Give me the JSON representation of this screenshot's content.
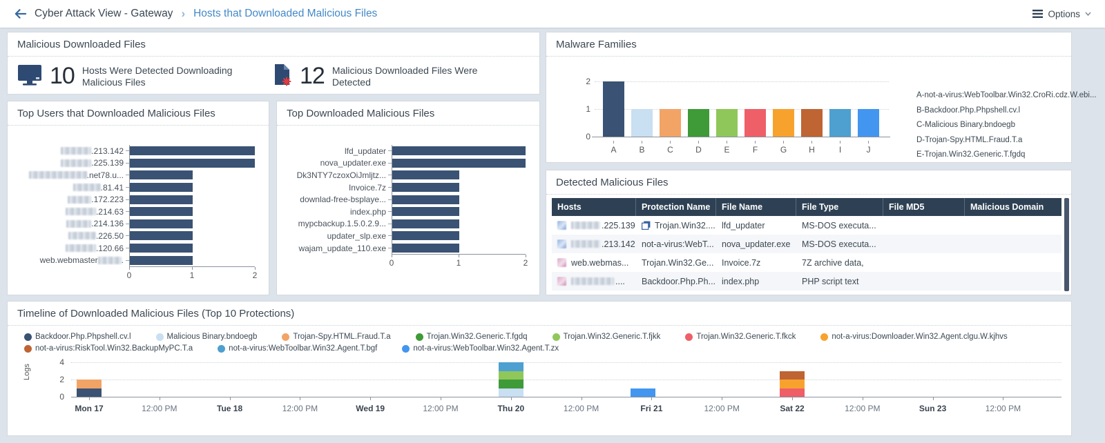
{
  "palette": {
    "navy": "#3a5273",
    "lightblue": "#c9dff2",
    "orange": "#f2a466",
    "green": "#3f9a38",
    "lightgreen": "#90c75a",
    "red": "#ee5f68",
    "amber": "#f8a22e",
    "rust": "#bf6433",
    "steel": "#4da0cf",
    "blue": "#4296f0"
  },
  "header": {
    "breadcrumb_root": "Cyber Attack View - Gateway",
    "breadcrumb_current": "Hosts that Downloaded Malicious Files",
    "options_label": "Options"
  },
  "summary": {
    "title": "Malicious Downloaded Files",
    "stats": [
      {
        "icon": "monitor-icon",
        "value": "10",
        "label": "Hosts Were Detected Downloading Malicious Files"
      },
      {
        "icon": "infected-file-icon",
        "value": "12",
        "label": "Malicious Downloaded Files Were Detected"
      }
    ]
  },
  "top_users": {
    "title": "Top Users that Downloaded Malicious Files",
    "xticks": [
      "0",
      "1",
      "2"
    ],
    "xmax": 2,
    "rows": [
      {
        "redact": 44,
        "label": ".213.142",
        "value": 2
      },
      {
        "redact": 44,
        "label": ".225.139",
        "value": 2
      },
      {
        "redact": 84,
        "label": ".net78.u...",
        "value": 1
      },
      {
        "redact": 40,
        "label": ".81.41",
        "value": 1
      },
      {
        "redact": 34,
        "label": ".172.223",
        "value": 1
      },
      {
        "redact": 44,
        "label": ".214.63",
        "value": 1
      },
      {
        "redact": 36,
        "label": ".214.136",
        "value": 1
      },
      {
        "redact": 40,
        "label": ".226.50",
        "value": 1
      },
      {
        "redact": 44,
        "label": ".120.66",
        "value": 1
      },
      {
        "pre": "web.webmaster",
        "redact": 34,
        "label": ".",
        "value": 1
      }
    ]
  },
  "top_files": {
    "title": "Top Downloaded Malicious Files",
    "xticks": [
      "0",
      "1",
      "2"
    ],
    "xmax": 2,
    "rows": [
      {
        "label": "lfd_updater",
        "value": 2
      },
      {
        "label": "nova_updater.exe",
        "value": 2
      },
      {
        "label": "Dk3NTY7czoxOiJmljtz...",
        "value": 1
      },
      {
        "label": "Invoice.7z",
        "value": 1
      },
      {
        "label": "downlad-free-bsplaye...",
        "value": 1
      },
      {
        "label": "index.php",
        "value": 1
      },
      {
        "label": "mypcbackup.1.5.0.2.9...",
        "value": 1
      },
      {
        "label": "updater_slp.exe",
        "value": 1
      },
      {
        "label": "wajam_update_110.exe",
        "value": 1
      }
    ]
  },
  "malware_families": {
    "title": "Malware Families",
    "yticks": [
      "2",
      "1",
      "0"
    ],
    "ymax": 2,
    "bars": [
      {
        "label": "A",
        "value": 2,
        "color": "navy"
      },
      {
        "label": "B",
        "value": 1,
        "color": "lightblue"
      },
      {
        "label": "C",
        "value": 1,
        "color": "orange"
      },
      {
        "label": "D",
        "value": 1,
        "color": "green"
      },
      {
        "label": "E",
        "value": 1,
        "color": "lightgreen"
      },
      {
        "label": "F",
        "value": 1,
        "color": "red"
      },
      {
        "label": "G",
        "value": 1,
        "color": "amber"
      },
      {
        "label": "H",
        "value": 1,
        "color": "rust"
      },
      {
        "label": "I",
        "value": 1,
        "color": "steel"
      },
      {
        "label": "J",
        "value": 1,
        "color": "blue"
      }
    ],
    "legend": [
      "A-not-a-virus:WebToolbar.Win32.CroRi.cdz.W.ebi...",
      "B-Backdoor.Php.Phpshell.cv.l",
      "C-Malicious Binary.bndoegb",
      "D-Trojan-Spy.HTML.Fraud.T.a",
      "E-Trojan.Win32.Generic.T.fgdq"
    ]
  },
  "detected_files": {
    "title": "Detected Malicious Files",
    "columns": [
      "Hosts",
      "Protection Name",
      "File Name",
      "File Type",
      "File MD5",
      "Malicious Domain"
    ],
    "rows": [
      {
        "host_icon": "blue",
        "host_redact": 42,
        "host": ".225.139",
        "protection_icon": true,
        "protection": "Trojan.Win32....",
        "file_name": "lfd_updater",
        "file_type": "MS-DOS executa...",
        "file_md5": "",
        "malicious_domain": ""
      },
      {
        "host_icon": "blue",
        "host_redact": 42,
        "host": ".213.142",
        "protection_icon": false,
        "protection": "not-a-virus:WebT...",
        "file_name": "nova_updater.exe",
        "file_type": "MS-DOS executa...",
        "file_md5": "",
        "malicious_domain": ""
      },
      {
        "host_icon": "pink",
        "host_redact": 0,
        "host": "web.webmas...",
        "protection_icon": false,
        "protection": "Trojan.Win32.Ge...",
        "file_name": "Invoice.7z",
        "file_type": "7Z archive data,",
        "file_md5": "",
        "malicious_domain": ""
      },
      {
        "host_icon": "pink",
        "host_redact": 62,
        "host": "....",
        "protection_icon": false,
        "protection": "Backdoor.Php.Ph...",
        "file_name": "index.php",
        "file_type": "PHP script text",
        "file_md5": "",
        "malicious_domain": ""
      }
    ]
  },
  "timeline": {
    "title": "Timeline of Downloaded Malicious Files (Top 10 Protections)",
    "ylabel": "Logs",
    "yticks": [
      "4",
      "2",
      "0"
    ],
    "ymax": 4,
    "legend_rows": [
      [
        {
          "label": "Backdoor.Php.Phpshell.cv.l",
          "color": "navy"
        },
        {
          "label": "Malicious Binary.bndoegb",
          "color": "lightblue"
        },
        {
          "label": "Trojan-Spy.HTML.Fraud.T.a",
          "color": "orange"
        },
        {
          "label": "Trojan.Win32.Generic.T.fgdq",
          "color": "green"
        },
        {
          "label": "Trojan.Win32.Generic.T.fjkk",
          "color": "lightgreen"
        },
        {
          "label": "Trojan.Win32.Generic.T.fkck",
          "color": "red"
        },
        {
          "label": "not-a-virus:Downloader.Win32.Agent.clgu.W.kjhvs",
          "color": "amber"
        }
      ],
      [
        {
          "label": "not-a-virus:RiskTool.Win32.BackupMyPC.T.a",
          "color": "rust"
        },
        {
          "label": "not-a-virus:WebToolbar.Win32.Agent.T.bgf",
          "color": "steel"
        },
        {
          "label": "not-a-virus:WebToolbar.Win32.Agent.T.zx",
          "color": "blue"
        }
      ]
    ],
    "xticks": [
      "Mon 17",
      "12:00 PM",
      "Tue 18",
      "12:00 PM",
      "Wed 19",
      "12:00 PM",
      "Thu 20",
      "12:00 PM",
      "Fri 21",
      "12:00 PM",
      "Sat 22",
      "12:00 PM",
      "Sun 23",
      "12:00 PM"
    ],
    "bars": [
      {
        "tick": 0,
        "dx": 0,
        "segments": [
          {
            "color": "navy",
            "value": 1
          },
          {
            "color": "orange",
            "value": 1
          }
        ]
      },
      {
        "tick": 6,
        "dx": 0,
        "segments": [
          {
            "color": "lightblue",
            "value": 1
          },
          {
            "color": "green",
            "value": 1
          },
          {
            "color": "lightgreen",
            "value": 1
          },
          {
            "color": "steel",
            "value": 1
          }
        ]
      },
      {
        "tick": 8,
        "dx": -12,
        "segments": [
          {
            "color": "blue",
            "value": 1
          }
        ]
      },
      {
        "tick": 10,
        "dx": 0,
        "segments": [
          {
            "color": "red",
            "value": 1
          },
          {
            "color": "amber",
            "value": 1
          },
          {
            "color": "rust",
            "value": 1
          }
        ]
      }
    ]
  }
}
